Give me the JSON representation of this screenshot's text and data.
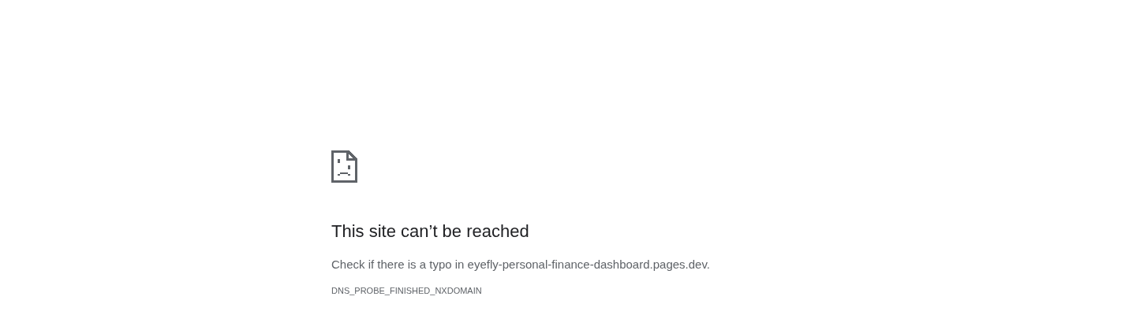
{
  "heading": "This site can’t be reached",
  "message": "Check if there is a typo in eyefly-personal-finance-dashboard.pages.dev.",
  "error_code": "DNS_PROBE_FINISHED_NXDOMAIN"
}
